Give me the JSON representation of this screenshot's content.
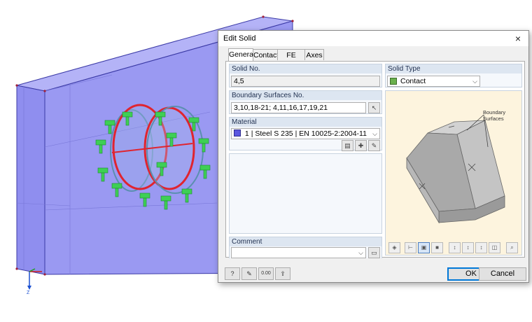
{
  "dialog": {
    "title": "Edit Solid",
    "close_glyph": "×",
    "tabs": [
      {
        "label": "General",
        "active": true
      },
      {
        "label": "Contact",
        "active": false
      },
      {
        "label": "FE Mesh",
        "active": false
      },
      {
        "label": "Axes",
        "active": false
      }
    ],
    "solid_no": {
      "label": "Solid No.",
      "value": "4,5"
    },
    "solid_type": {
      "label": "Solid Type",
      "value": "Contact",
      "swatch_color": "#6ab04c"
    },
    "boundary_surfaces": {
      "label": "Boundary Surfaces No.",
      "value": "3,10,18-21; 4,11,16,17,19,21"
    },
    "material": {
      "label": "Material",
      "number": "1",
      "name": "Steel S 235",
      "standard": "EN 10025-2:2004-11",
      "swatch_color": "#5b57e0"
    },
    "comment": {
      "label": "Comment",
      "value": ""
    },
    "preview": {
      "annotation_line1": "Boundary",
      "annotation_line2": "Surfaces"
    },
    "buttons": {
      "ok": "OK",
      "cancel": "Cancel"
    },
    "footer_icons": [
      "help-icon",
      "edit-icon",
      "units-icon",
      "export-icon"
    ],
    "units_label": "0.00"
  },
  "viewport": {
    "axis_label": "Z",
    "colors": {
      "solid_fill": "#9a99f2",
      "solid_edge": "#3b3aa6",
      "contact_ring": "#e0242f",
      "support_green": "#3ecf55",
      "accent_blue": "#0078d7"
    }
  }
}
